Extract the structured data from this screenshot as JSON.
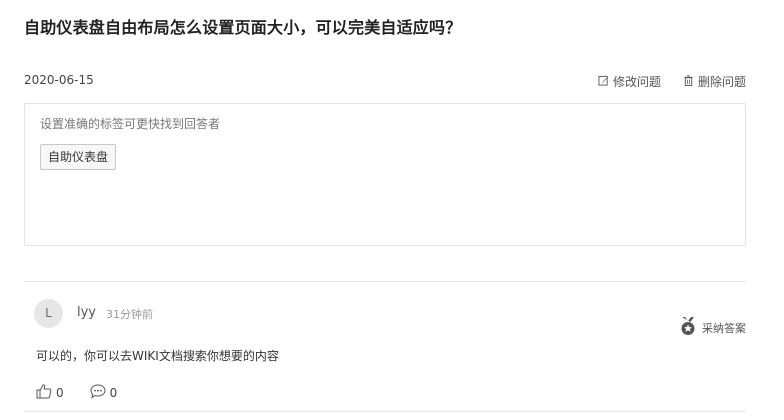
{
  "question": {
    "title": "自助仪表盘自由布局怎么设置页面大小，可以完美自适应吗？",
    "date": "2020-06-15",
    "edit_label": "修改问题",
    "delete_label": "删除问题"
  },
  "tags": {
    "hint": "设置准确的标签可更快找到回答者",
    "items": [
      "自助仪表盘"
    ]
  },
  "answer": {
    "avatar_letter": "L",
    "user": "lyy",
    "time": "31分钟前",
    "accept_label": "采纳答案",
    "content": "可以的，你可以去WIKI文档搜索你想要的内容",
    "likes": "0",
    "comments": "0"
  }
}
